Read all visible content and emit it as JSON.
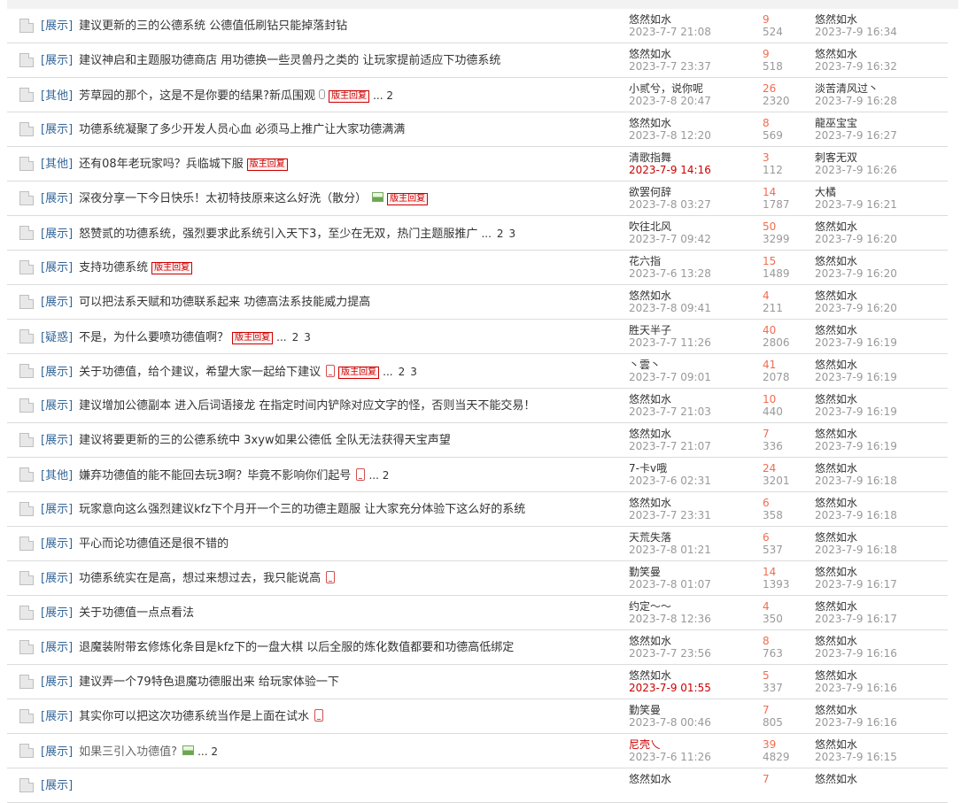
{
  "rows": [
    {
      "cat": "[展示]",
      "title": "建议更新的三的公德系统 公德值低刷钻只能掉落封钻",
      "badge": false,
      "mobile": false,
      "attach": false,
      "img": false,
      "pages": [],
      "author": "悠然如水",
      "author_red": false,
      "time": "2023-7-7 21:08",
      "time_red": false,
      "replies": "9",
      "views": "524",
      "last_author": "悠然如水",
      "last_time": "2023-7-9 16:34"
    },
    {
      "cat": "[展示]",
      "title": "建议神启和主题服功德商店 用功德换一些灵兽丹之类的 让玩家提前适应下功德系统",
      "badge": false,
      "mobile": false,
      "attach": false,
      "img": false,
      "pages": [],
      "author": "悠然如水",
      "author_red": false,
      "time": "2023-7-7 23:37",
      "time_red": false,
      "replies": "9",
      "views": "518",
      "last_author": "悠然如水",
      "last_time": "2023-7-9 16:32"
    },
    {
      "cat": "[其他]",
      "title": "芳草园的那个，这是不是你要的结果?新瓜围观",
      "badge": true,
      "mobile": false,
      "attach": true,
      "img": false,
      "pages": [
        "... 2"
      ],
      "author": "小贰兮，说你呢",
      "author_red": false,
      "time": "2023-7-8 20:47",
      "time_red": false,
      "replies": "26",
      "views": "2320",
      "last_author": "淡苦清风过丶",
      "last_time": "2023-7-9 16:28"
    },
    {
      "cat": "[展示]",
      "title": "功德系统凝聚了多少开发人员心血 必须马上推广让大家功德满满",
      "badge": false,
      "mobile": false,
      "attach": false,
      "img": false,
      "pages": [],
      "author": "悠然如水",
      "author_red": false,
      "time": "2023-7-8 12:20",
      "time_red": false,
      "replies": "8",
      "views": "569",
      "last_author": "龍巫宝宝",
      "last_time": "2023-7-9 16:27"
    },
    {
      "cat": "[其他]",
      "title": "还有08年老玩家吗？兵临城下服",
      "badge": true,
      "mobile": false,
      "attach": false,
      "img": false,
      "pages": [],
      "author": "清歌指舞",
      "author_red": false,
      "time": "2023-7-9 14:16",
      "time_red": true,
      "replies": "3",
      "views": "112",
      "last_author": "刺客无双",
      "last_time": "2023-7-9 16:26"
    },
    {
      "cat": "[展示]",
      "title": "深夜分享一下今日快乐！太初特技原来这么好洗（散分）",
      "badge": true,
      "mobile": false,
      "attach": false,
      "img": true,
      "pages": [],
      "author": "欲罢何辞",
      "author_red": false,
      "time": "2023-7-8 03:27",
      "time_red": false,
      "replies": "14",
      "views": "1787",
      "last_author": "大橘",
      "last_time": "2023-7-9 16:21"
    },
    {
      "cat": "[展示]",
      "title": "怒赞贰的功德系统，强烈要求此系统引入天下3，至少在无双，热门主题服推广",
      "badge": false,
      "mobile": false,
      "attach": false,
      "img": false,
      "pages": [
        "...",
        "2",
        "3"
      ],
      "author": "吹往北风",
      "author_red": false,
      "time": "2023-7-7 09:42",
      "time_red": false,
      "replies": "50",
      "views": "3299",
      "last_author": "悠然如水",
      "last_time": "2023-7-9 16:20"
    },
    {
      "cat": "[展示]",
      "title": "支持功德系统",
      "badge": true,
      "mobile": false,
      "attach": false,
      "img": false,
      "pages": [],
      "author": "花六指",
      "author_red": false,
      "time": "2023-7-6 13:28",
      "time_red": false,
      "replies": "15",
      "views": "1489",
      "last_author": "悠然如水",
      "last_time": "2023-7-9 16:20"
    },
    {
      "cat": "[展示]",
      "title": "可以把法系天赋和功德联系起来 功德高法系技能威力提高",
      "badge": false,
      "mobile": false,
      "attach": false,
      "img": false,
      "pages": [],
      "author": "悠然如水",
      "author_red": false,
      "time": "2023-7-8 09:41",
      "time_red": false,
      "replies": "4",
      "views": "211",
      "last_author": "悠然如水",
      "last_time": "2023-7-9 16:20"
    },
    {
      "cat": "[疑惑]",
      "title": "不是，为什么要喷功德值啊？",
      "badge": true,
      "mobile": false,
      "attach": false,
      "img": false,
      "pages": [
        "...",
        "2",
        "3"
      ],
      "author": "胜天半子",
      "author_red": false,
      "time": "2023-7-7 11:26",
      "time_red": false,
      "replies": "40",
      "views": "2806",
      "last_author": "悠然如水",
      "last_time": "2023-7-9 16:19"
    },
    {
      "cat": "[展示]",
      "title": "关于功德值，给个建议，希望大家一起给下建议",
      "badge": true,
      "mobile": true,
      "attach": false,
      "img": false,
      "pages": [
        "...",
        "2",
        "3"
      ],
      "author": "丶雲丶",
      "author_red": false,
      "time": "2023-7-7 09:01",
      "time_red": false,
      "replies": "41",
      "views": "2078",
      "last_author": "悠然如水",
      "last_time": "2023-7-9 16:19"
    },
    {
      "cat": "[展示]",
      "title": "建议增加公德副本 进入后词语接龙 在指定时间内铲除对应文字的怪，否则当天不能交易！",
      "badge": false,
      "mobile": false,
      "attach": false,
      "img": false,
      "pages": [],
      "author": "悠然如水",
      "author_red": false,
      "time": "2023-7-7 21:03",
      "time_red": false,
      "replies": "10",
      "views": "440",
      "last_author": "悠然如水",
      "last_time": "2023-7-9 16:19"
    },
    {
      "cat": "[展示]",
      "title": "建议将要更新的三的公德系统中 3xyw如果公德低 全队无法获得天宝声望",
      "badge": false,
      "mobile": false,
      "attach": false,
      "img": false,
      "pages": [],
      "author": "悠然如水",
      "author_red": false,
      "time": "2023-7-7 21:07",
      "time_red": false,
      "replies": "7",
      "views": "336",
      "last_author": "悠然如水",
      "last_time": "2023-7-9 16:19"
    },
    {
      "cat": "[其他]",
      "title": "嫌弃功德值的能不能回去玩3啊？毕竟不影响你们起号",
      "badge": false,
      "mobile": true,
      "attach": false,
      "img": false,
      "pages": [
        "... 2"
      ],
      "author": "7-卡v哦",
      "author_red": false,
      "time": "2023-7-6 02:31",
      "time_red": false,
      "replies": "24",
      "views": "3201",
      "last_author": "悠然如水",
      "last_time": "2023-7-9 16:18"
    },
    {
      "cat": "[展示]",
      "title": "玩家意向这么强烈建议kfz下个月开一个三的功德主题服 让大家充分体验下这么好的系统",
      "badge": false,
      "mobile": false,
      "attach": false,
      "img": false,
      "pages": [],
      "author": "悠然如水",
      "author_red": false,
      "time": "2023-7-7 23:31",
      "time_red": false,
      "replies": "6",
      "views": "358",
      "last_author": "悠然如水",
      "last_time": "2023-7-9 16:18"
    },
    {
      "cat": "[展示]",
      "title": "平心而论功德值还是很不错的",
      "badge": false,
      "mobile": false,
      "attach": false,
      "img": false,
      "pages": [],
      "author": "天荒失落",
      "author_red": false,
      "time": "2023-7-8 01:21",
      "time_red": false,
      "replies": "6",
      "views": "537",
      "last_author": "悠然如水",
      "last_time": "2023-7-9 16:18"
    },
    {
      "cat": "[展示]",
      "title": "功德系统实在是高，想过来想过去，我只能说高",
      "badge": false,
      "mobile": true,
      "attach": false,
      "img": false,
      "pages": [],
      "author": "勤笑曼",
      "author_red": false,
      "time": "2023-7-8 01:07",
      "time_red": false,
      "replies": "14",
      "views": "1393",
      "last_author": "悠然如水",
      "last_time": "2023-7-9 16:17"
    },
    {
      "cat": "[展示]",
      "title": "关于功德值一点点看法",
      "badge": false,
      "mobile": false,
      "attach": false,
      "img": false,
      "pages": [],
      "author": "约定～～",
      "author_red": false,
      "time": "2023-7-8 12:36",
      "time_red": false,
      "replies": "4",
      "views": "350",
      "last_author": "悠然如水",
      "last_time": "2023-7-9 16:17"
    },
    {
      "cat": "[展示]",
      "title": "退魔装附带玄修炼化条目是kfz下的一盘大棋 以后全服的炼化数值都要和功德高低绑定",
      "badge": false,
      "mobile": false,
      "attach": false,
      "img": false,
      "pages": [],
      "author": "悠然如水",
      "author_red": false,
      "time": "2023-7-7 23:56",
      "time_red": false,
      "replies": "8",
      "views": "763",
      "last_author": "悠然如水",
      "last_time": "2023-7-9 16:16"
    },
    {
      "cat": "[展示]",
      "title": "建议弄一个79特色退魔功德服出来 给玩家体验一下",
      "badge": false,
      "mobile": false,
      "attach": false,
      "img": false,
      "pages": [],
      "author": "悠然如水",
      "author_red": false,
      "time": "2023-7-9 01:55",
      "time_red": true,
      "replies": "5",
      "views": "337",
      "last_author": "悠然如水",
      "last_time": "2023-7-9 16:16"
    },
    {
      "cat": "[展示]",
      "title": "其实你可以把这次功德系统当作是上面在试水",
      "badge": false,
      "mobile": true,
      "attach": false,
      "img": false,
      "pages": [],
      "author": "勤笑曼",
      "author_red": false,
      "time": "2023-7-8 00:46",
      "time_red": false,
      "replies": "7",
      "views": "805",
      "last_author": "悠然如水",
      "last_time": "2023-7-9 16:16"
    },
    {
      "cat": "[展示]",
      "title": "如果三引入功德值?",
      "badge": false,
      "mobile": false,
      "attach": false,
      "img": true,
      "pages": [
        "... 2"
      ],
      "author": "尼壳乀",
      "author_red": true,
      "time": "2023-7-6 11:26",
      "time_red": false,
      "replies": "39",
      "views": "4829",
      "last_author": "悠然如水",
      "last_time": "2023-7-9 16:15",
      "gray": true
    },
    {
      "cat": "[展示]",
      "title": "",
      "badge": false,
      "mobile": false,
      "attach": false,
      "img": false,
      "pages": [],
      "author": "悠然如水",
      "author_red": false,
      "time": "",
      "time_red": false,
      "replies": "7",
      "views": "",
      "last_author": "悠然如水",
      "last_time": ""
    }
  ],
  "badge_text": "版主回复",
  "icons": {
    "row": "doc-icon",
    "mobile": "mobile-icon",
    "attach": "paperclip-icon",
    "image": "image-icon"
  }
}
